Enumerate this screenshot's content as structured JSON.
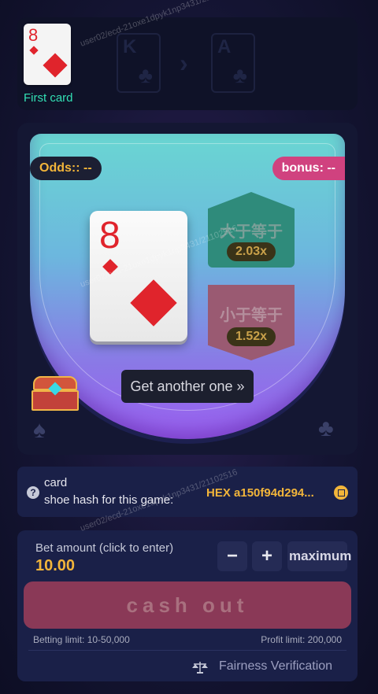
{
  "history": {
    "first_card": {
      "rank": "8",
      "suit": "diamond"
    },
    "first_card_label": "First card",
    "ghost_cards": [
      {
        "rank": "K",
        "suit": "club"
      },
      {
        "rank": "A",
        "suit": "club"
      }
    ]
  },
  "board": {
    "odds_label": "Odds:: --",
    "bonus_label": "bonus: --",
    "current_card": {
      "rank": "8",
      "suit": "diamond"
    },
    "higher": {
      "label": "大于等于",
      "odds": "2.03x"
    },
    "lower": {
      "label": "小于等于",
      "odds": "1.52x"
    },
    "another_button": "Get another one »"
  },
  "hash": {
    "line1": "card",
    "line2": "shoe hash for this game:",
    "value": "HEX a150f94d294..."
  },
  "bet": {
    "label": "Bet amount (click to enter)",
    "amount": "10.00",
    "minus": "−",
    "plus": "+",
    "max": "maximum",
    "cashout": "cash out",
    "betting_limit": "Betting limit: 10-50,000",
    "profit_limit": "Profit limit: 200,000",
    "fairness": "Fairness Verification"
  },
  "colors": {
    "accent_gold": "#f2b53a",
    "accent_teal": "#32e0b4",
    "card_red": "#e0242c",
    "bonus_pink": "#d0427f",
    "cashout": "#8a3957"
  },
  "watermark": "user02/ecd-21oxe1dpyk1np3431/21102516"
}
